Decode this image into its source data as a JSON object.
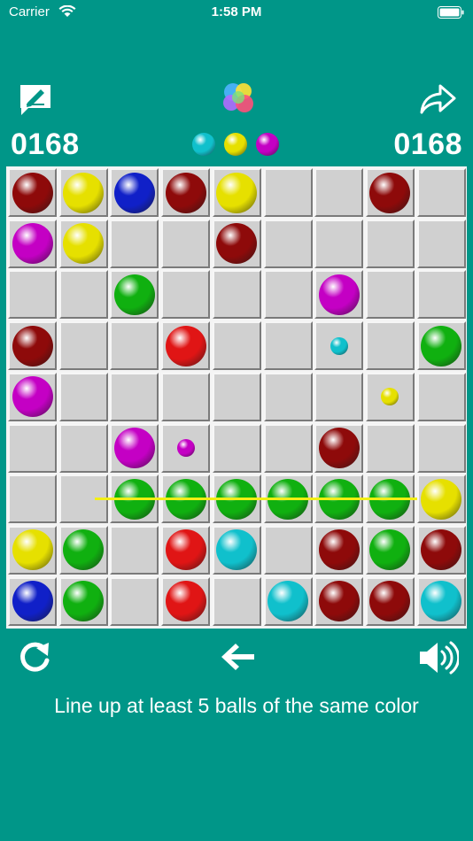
{
  "status_bar": {
    "carrier": "Carrier",
    "time": "1:58 PM"
  },
  "scores": {
    "left": "0168",
    "right": "0168"
  },
  "next_balls": [
    "cyan",
    "yellow",
    "magenta"
  ],
  "board": {
    "rows": [
      [
        "darkred",
        "yellow",
        "blue",
        "darkred",
        "yellow",
        "",
        "",
        "darkred",
        ""
      ],
      [
        "magenta",
        "yellow",
        "",
        "",
        "darkred",
        "",
        "",
        "",
        ""
      ],
      [
        "",
        "",
        "green",
        "",
        "",
        "",
        "magenta",
        "",
        ""
      ],
      [
        "darkred",
        "",
        "",
        "red",
        "",
        "",
        "cyan-small",
        "",
        "green"
      ],
      [
        "magenta",
        "",
        "",
        "",
        "",
        "",
        "",
        "yellow-small",
        ""
      ],
      [
        "",
        "",
        "magenta",
        "magenta-small",
        "",
        "",
        "darkred",
        "",
        ""
      ],
      [
        "",
        "",
        "green",
        "green",
        "green",
        "green",
        "green",
        "green",
        "yellow"
      ],
      [
        "yellow",
        "green",
        "",
        "red",
        "cyan",
        "",
        "darkred",
        "green",
        "darkred"
      ],
      [
        "blue",
        "green",
        "",
        "red",
        "",
        "cyan",
        "darkred",
        "darkred",
        "cyan"
      ]
    ]
  },
  "ball_colors": {
    "darkred": "#8e0a0a",
    "red": "#e01515",
    "yellow": "#e6e000",
    "blue": "#1020c8",
    "magenta": "#c400c4",
    "green": "#10b010",
    "cyan": "#10c0cc"
  },
  "icons": {
    "edit": "edit-note-icon",
    "logo": "app-logo-icon",
    "share": "share-icon",
    "restart": "restart-icon",
    "undo": "undo-arrow-icon",
    "sound": "speaker-icon"
  },
  "hint_text": "Line up at least 5 balls of the same color"
}
